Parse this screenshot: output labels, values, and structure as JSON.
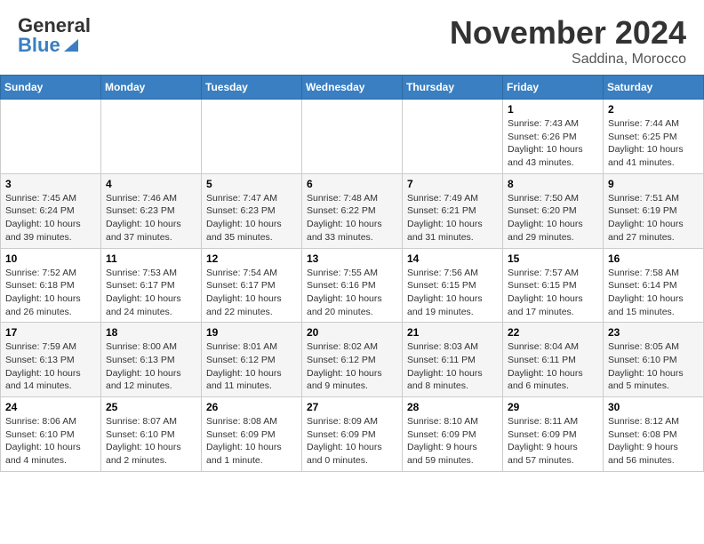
{
  "header": {
    "logo_line1": "General",
    "logo_line2": "Blue",
    "month": "November 2024",
    "location": "Saddina, Morocco"
  },
  "days_of_week": [
    "Sunday",
    "Monday",
    "Tuesday",
    "Wednesday",
    "Thursday",
    "Friday",
    "Saturday"
  ],
  "weeks": [
    {
      "days": [
        {
          "num": "",
          "info": ""
        },
        {
          "num": "",
          "info": ""
        },
        {
          "num": "",
          "info": ""
        },
        {
          "num": "",
          "info": ""
        },
        {
          "num": "",
          "info": ""
        },
        {
          "num": "1",
          "info": "Sunrise: 7:43 AM\nSunset: 6:26 PM\nDaylight: 10 hours\nand 43 minutes."
        },
        {
          "num": "2",
          "info": "Sunrise: 7:44 AM\nSunset: 6:25 PM\nDaylight: 10 hours\nand 41 minutes."
        }
      ]
    },
    {
      "days": [
        {
          "num": "3",
          "info": "Sunrise: 7:45 AM\nSunset: 6:24 PM\nDaylight: 10 hours\nand 39 minutes."
        },
        {
          "num": "4",
          "info": "Sunrise: 7:46 AM\nSunset: 6:23 PM\nDaylight: 10 hours\nand 37 minutes."
        },
        {
          "num": "5",
          "info": "Sunrise: 7:47 AM\nSunset: 6:23 PM\nDaylight: 10 hours\nand 35 minutes."
        },
        {
          "num": "6",
          "info": "Sunrise: 7:48 AM\nSunset: 6:22 PM\nDaylight: 10 hours\nand 33 minutes."
        },
        {
          "num": "7",
          "info": "Sunrise: 7:49 AM\nSunset: 6:21 PM\nDaylight: 10 hours\nand 31 minutes."
        },
        {
          "num": "8",
          "info": "Sunrise: 7:50 AM\nSunset: 6:20 PM\nDaylight: 10 hours\nand 29 minutes."
        },
        {
          "num": "9",
          "info": "Sunrise: 7:51 AM\nSunset: 6:19 PM\nDaylight: 10 hours\nand 27 minutes."
        }
      ]
    },
    {
      "days": [
        {
          "num": "10",
          "info": "Sunrise: 7:52 AM\nSunset: 6:18 PM\nDaylight: 10 hours\nand 26 minutes."
        },
        {
          "num": "11",
          "info": "Sunrise: 7:53 AM\nSunset: 6:17 PM\nDaylight: 10 hours\nand 24 minutes."
        },
        {
          "num": "12",
          "info": "Sunrise: 7:54 AM\nSunset: 6:17 PM\nDaylight: 10 hours\nand 22 minutes."
        },
        {
          "num": "13",
          "info": "Sunrise: 7:55 AM\nSunset: 6:16 PM\nDaylight: 10 hours\nand 20 minutes."
        },
        {
          "num": "14",
          "info": "Sunrise: 7:56 AM\nSunset: 6:15 PM\nDaylight: 10 hours\nand 19 minutes."
        },
        {
          "num": "15",
          "info": "Sunrise: 7:57 AM\nSunset: 6:15 PM\nDaylight: 10 hours\nand 17 minutes."
        },
        {
          "num": "16",
          "info": "Sunrise: 7:58 AM\nSunset: 6:14 PM\nDaylight: 10 hours\nand 15 minutes."
        }
      ]
    },
    {
      "days": [
        {
          "num": "17",
          "info": "Sunrise: 7:59 AM\nSunset: 6:13 PM\nDaylight: 10 hours\nand 14 minutes."
        },
        {
          "num": "18",
          "info": "Sunrise: 8:00 AM\nSunset: 6:13 PM\nDaylight: 10 hours\nand 12 minutes."
        },
        {
          "num": "19",
          "info": "Sunrise: 8:01 AM\nSunset: 6:12 PM\nDaylight: 10 hours\nand 11 minutes."
        },
        {
          "num": "20",
          "info": "Sunrise: 8:02 AM\nSunset: 6:12 PM\nDaylight: 10 hours\nand 9 minutes."
        },
        {
          "num": "21",
          "info": "Sunrise: 8:03 AM\nSunset: 6:11 PM\nDaylight: 10 hours\nand 8 minutes."
        },
        {
          "num": "22",
          "info": "Sunrise: 8:04 AM\nSunset: 6:11 PM\nDaylight: 10 hours\nand 6 minutes."
        },
        {
          "num": "23",
          "info": "Sunrise: 8:05 AM\nSunset: 6:10 PM\nDaylight: 10 hours\nand 5 minutes."
        }
      ]
    },
    {
      "days": [
        {
          "num": "24",
          "info": "Sunrise: 8:06 AM\nSunset: 6:10 PM\nDaylight: 10 hours\nand 4 minutes."
        },
        {
          "num": "25",
          "info": "Sunrise: 8:07 AM\nSunset: 6:10 PM\nDaylight: 10 hours\nand 2 minutes."
        },
        {
          "num": "26",
          "info": "Sunrise: 8:08 AM\nSunset: 6:09 PM\nDaylight: 10 hours\nand 1 minute."
        },
        {
          "num": "27",
          "info": "Sunrise: 8:09 AM\nSunset: 6:09 PM\nDaylight: 10 hours\nand 0 minutes."
        },
        {
          "num": "28",
          "info": "Sunrise: 8:10 AM\nSunset: 6:09 PM\nDaylight: 9 hours\nand 59 minutes."
        },
        {
          "num": "29",
          "info": "Sunrise: 8:11 AM\nSunset: 6:09 PM\nDaylight: 9 hours\nand 57 minutes."
        },
        {
          "num": "30",
          "info": "Sunrise: 8:12 AM\nSunset: 6:08 PM\nDaylight: 9 hours\nand 56 minutes."
        }
      ]
    }
  ]
}
